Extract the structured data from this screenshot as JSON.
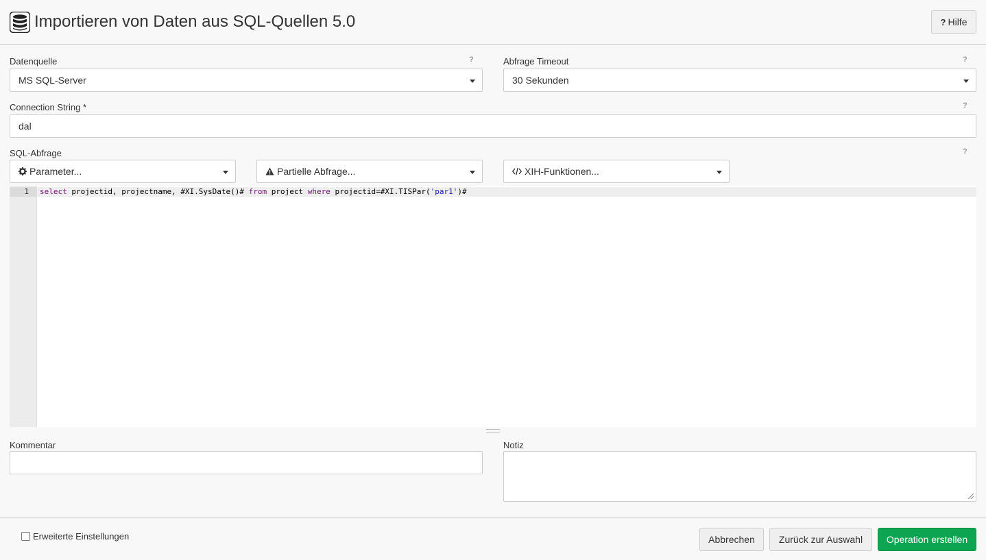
{
  "header": {
    "title": "Importieren von Daten aus SQL-Quellen 5.0",
    "title_icon": "database-icon",
    "help_label": "Hilfe",
    "help_icon_glyph": "?"
  },
  "datasource": {
    "label": "Datenquelle",
    "value": "MS SQL-Server"
  },
  "timeout": {
    "label": "Abfrage Timeout",
    "value": "30 Sekunden"
  },
  "connection": {
    "label": "Connection String *",
    "value": "dal"
  },
  "sql": {
    "label": "SQL-Abfrage",
    "parameter_label": "Parameter...",
    "parameter_icon": "gear-icon",
    "partial_label": "Partielle Abfrage...",
    "partial_icon": "warning-icon",
    "functions_label": "XIH-Funktionen...",
    "functions_icon": "code-icon",
    "line_number": "1",
    "code": {
      "t1": "select",
      "t2": " projectid, projectname, #XI.SysDate()# ",
      "t3": "from",
      "t4": " project ",
      "t5": "where",
      "t6": " projectid=#XI.TISPar(",
      "t7": "'par1'",
      "t8": ")#"
    }
  },
  "comment": {
    "label": "Kommentar",
    "value": ""
  },
  "note": {
    "label": "Notiz",
    "value": ""
  },
  "help_marker": "?",
  "footer": {
    "advanced_label": "Erweiterte Einstellungen",
    "cancel_label": "Abbrechen",
    "back_label": "Zurück zur Auswahl",
    "create_label": "Operation erstellen"
  },
  "colors": {
    "primary": "#0ea552",
    "keyword": "#7a0f7a",
    "string": "#1a1aa6"
  }
}
